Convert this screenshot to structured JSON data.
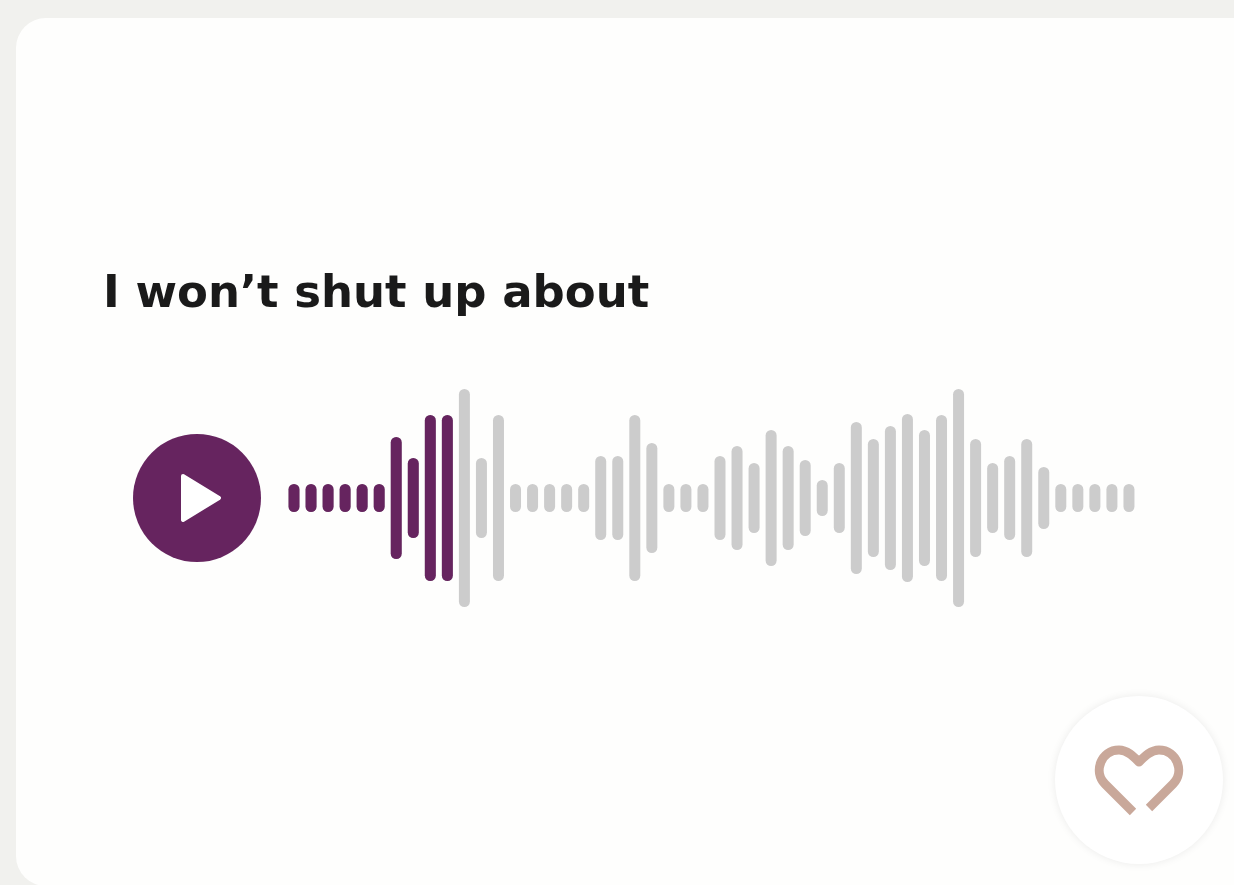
{
  "voice_prompt": {
    "title": "I won’t shut up about",
    "level": 0.2
  }
}
